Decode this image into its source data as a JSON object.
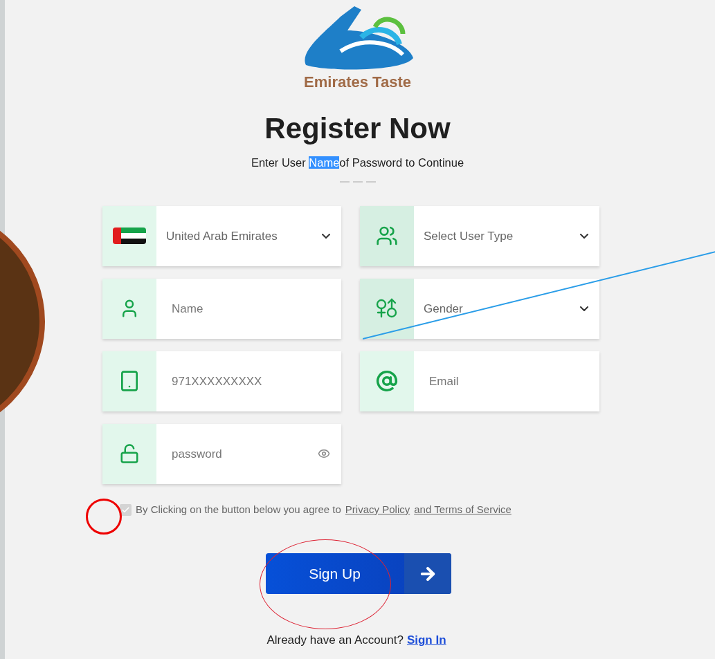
{
  "logo": {
    "text": "Emirates Taste"
  },
  "heading": "Register Now",
  "subtitle": [
    {
      "text": "Enter User ",
      "selected": false
    },
    {
      "text": "Name",
      "selected": true
    },
    {
      "text": "of Password to Continue",
      "selected": false
    }
  ],
  "fields": [
    {
      "kind": "country",
      "value": "United Arab Emirates"
    },
    {
      "kind": "select",
      "placeholder": "Select User Type"
    },
    {
      "kind": "input",
      "placeholder": "Name"
    },
    {
      "kind": "select",
      "placeholder": "Gender"
    },
    {
      "kind": "input",
      "placeholder": "971XXXXXXXXX"
    },
    {
      "kind": "input",
      "placeholder": "Email"
    },
    {
      "kind": "password",
      "placeholder": "password"
    }
  ],
  "agreement": {
    "checked": true,
    "disabled": true,
    "text": "By Clicking on the button below you agree to",
    "link_1": "Privacy Policy",
    "link_2": "and Terms of Service"
  },
  "submit": "Sign Up",
  "footer": {
    "text": "Already have an Account?",
    "link": "Sign In"
  }
}
